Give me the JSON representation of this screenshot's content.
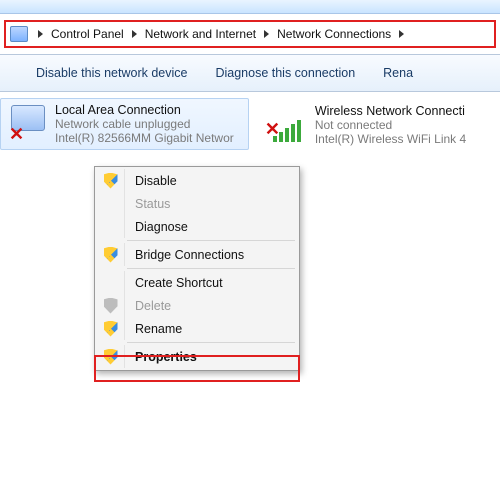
{
  "breadcrumb": {
    "items": [
      "Control Panel",
      "Network and Internet",
      "Network Connections"
    ]
  },
  "toolbar": {
    "disable": "Disable this network device",
    "diagnose": "Diagnose this connection",
    "rename": "Rena"
  },
  "connections": [
    {
      "name": "Local Area Connection",
      "status": "Network cable unplugged",
      "device": "Intel(R) 82566MM Gigabit Networ",
      "selected": true,
      "error": true
    },
    {
      "name": "Wireless Network Connecti",
      "status": "Not connected",
      "device": "Intel(R) Wireless WiFi Link 4",
      "selected": false,
      "error": true
    }
  ],
  "context_menu": {
    "disable": "Disable",
    "status": "Status",
    "diagnose": "Diagnose",
    "bridge": "Bridge Connections",
    "shortcut": "Create Shortcut",
    "delete": "Delete",
    "rename": "Rename",
    "properties": "Properties"
  }
}
